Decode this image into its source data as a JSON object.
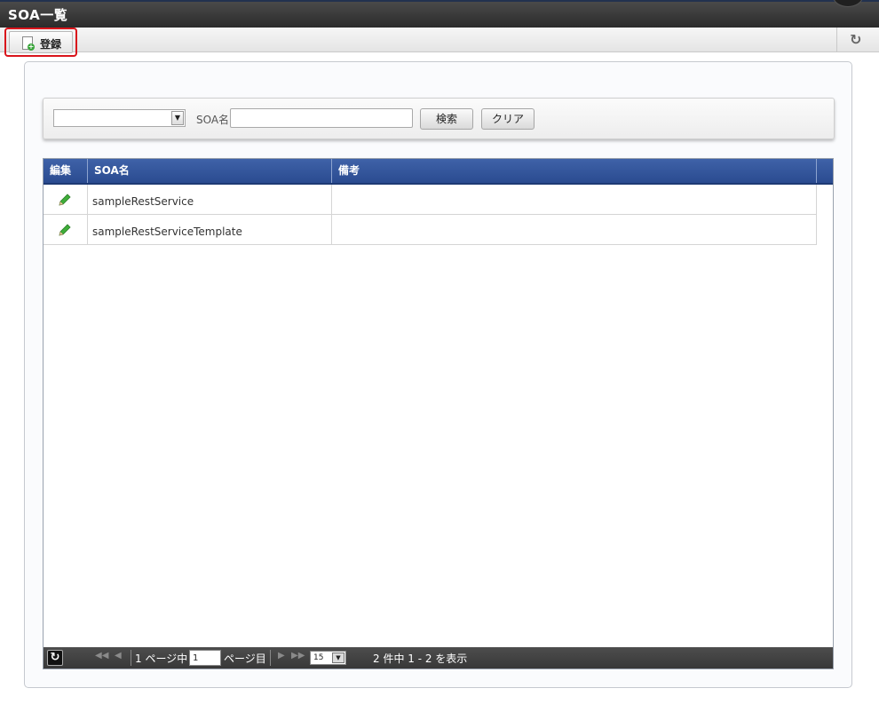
{
  "window": {
    "title": "SOA一覧"
  },
  "toolbar": {
    "register_label": "登録",
    "refresh_icon": "refresh-icon"
  },
  "search": {
    "type_select_value": "",
    "name_label": "SOA名",
    "name_value": "",
    "search_button": "検索",
    "clear_button": "クリア"
  },
  "grid": {
    "columns": [
      "編集",
      "SOA名",
      "備考"
    ],
    "rows": [
      {
        "name": "sampleRestService",
        "note": ""
      },
      {
        "name": "sampleRestServiceTemplate",
        "note": ""
      }
    ]
  },
  "pager": {
    "page_prefix": "1 ページ中",
    "current_page": "1",
    "page_suffix": "ページ目",
    "page_size": "15",
    "summary": "2 件中 1 - 2 を表示"
  }
}
